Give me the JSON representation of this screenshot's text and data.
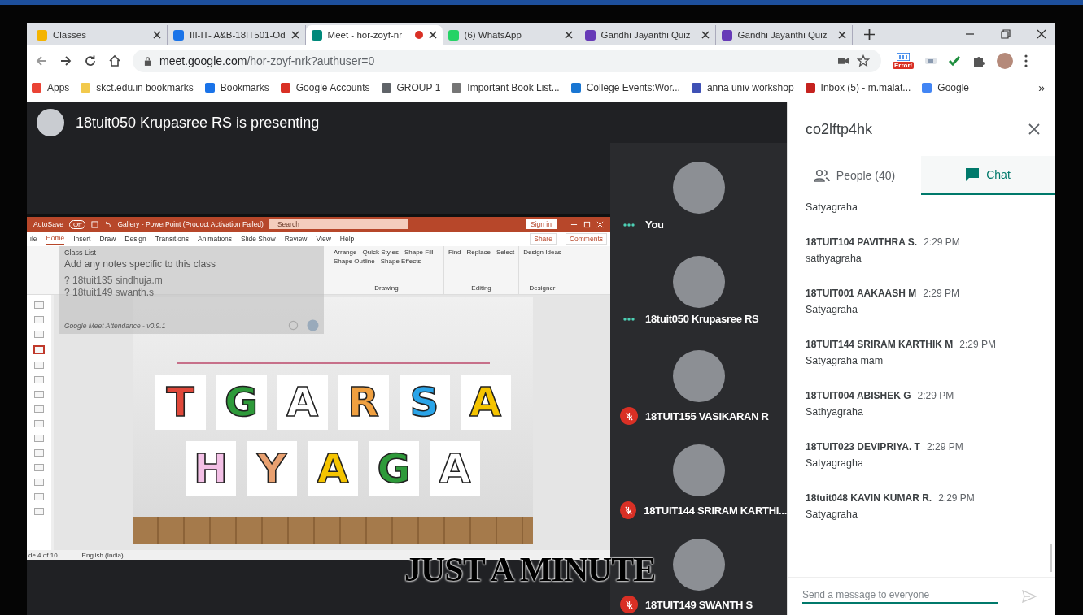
{
  "browser": {
    "tabs": [
      {
        "title": "Classes",
        "color": "#f4b400",
        "recording": false,
        "selected": false
      },
      {
        "title": "III-IT- A&B-18IT501-Od",
        "color": "#1a73e8",
        "recording": false,
        "selected": false
      },
      {
        "title": "Meet - hor-zoyf-nr",
        "color": "#00897b",
        "recording": true,
        "selected": true
      },
      {
        "title": "(6) WhatsApp",
        "color": "#25d366",
        "recording": false,
        "selected": false
      },
      {
        "title": "Gandhi Jayanthi Quiz",
        "color": "#673ab7",
        "recording": false,
        "selected": false
      },
      {
        "title": "Gandhi Jayanthi Quiz",
        "color": "#673ab7",
        "recording": false,
        "selected": false
      }
    ],
    "address": {
      "host": "meet.google.com",
      "path": "/hor-zoyf-nrk?authuser=0"
    },
    "extension_badge": "Error!",
    "bookmarks": [
      {
        "label": "Apps",
        "color": "#ea4335"
      },
      {
        "label": "skct.edu.in bookmarks",
        "color": "#f2c94c"
      },
      {
        "label": "Bookmarks",
        "color": "#1a73e8"
      },
      {
        "label": "Google Accounts",
        "color": "#d93025"
      },
      {
        "label": "GROUP 1",
        "color": "#5f6368"
      },
      {
        "label": "Important Book List...",
        "color": "#757575"
      },
      {
        "label": "College Events:Wor...",
        "color": "#1976d2"
      },
      {
        "label": "anna univ workshop",
        "color": "#3f51b5"
      },
      {
        "label": "Inbox (5) - m.malat...",
        "color": "#c5221f"
      },
      {
        "label": "Google",
        "color": "#4285f4"
      }
    ],
    "more_bookmarks": "»"
  },
  "meet": {
    "presenter": "18tuit050 Krupasree RS is presenting",
    "presentation": {
      "autosave": "AutoSave",
      "autosave_state": "Off",
      "title": "Gallery - PowerPoint (Product Activation Failed)",
      "search_placeholder": "Search",
      "sign_in": "Sign in",
      "tabs": [
        {
          "label": "ile",
          "selected": false
        },
        {
          "label": "Home",
          "selected": true
        },
        {
          "label": "Insert",
          "selected": false
        },
        {
          "label": "Draw",
          "selected": false
        },
        {
          "label": "Design",
          "selected": false
        },
        {
          "label": "Transitions",
          "selected": false
        },
        {
          "label": "Animations",
          "selected": false
        },
        {
          "label": "Slide Show",
          "selected": false
        },
        {
          "label": "Review",
          "selected": false
        },
        {
          "label": "View",
          "selected": false
        },
        {
          "label": "Help",
          "selected": false
        }
      ],
      "share": "Share",
      "comments": "Comments",
      "groups": [
        {
          "label": "Drawing",
          "commands": [
            "Arrange",
            "Quick Styles",
            "Shape Fill",
            "Shape Outline",
            "Shape Effects"
          ]
        },
        {
          "label": "Editing",
          "commands": [
            "Find",
            "Replace",
            "Select"
          ]
        },
        {
          "label": "Designer",
          "commands": [
            "Design Ideas"
          ]
        }
      ],
      "thumbnails": [
        {
          "selected": false
        },
        {
          "selected": false
        },
        {
          "selected": false
        },
        {
          "selected": true
        },
        {
          "selected": false
        },
        {
          "selected": false
        },
        {
          "selected": false
        },
        {
          "selected": false
        },
        {
          "selected": false
        },
        {
          "selected": false
        },
        {
          "selected": false
        },
        {
          "selected": false
        },
        {
          "selected": false
        },
        {
          "selected": false
        },
        {
          "selected": false
        }
      ],
      "slide_rows": [
        [
          {
            "letter": "T",
            "color": "#e0483a"
          },
          {
            "letter": "G",
            "color": "#2e9a3a"
          },
          {
            "letter": "A",
            "color": "#ffffff"
          },
          {
            "letter": "R",
            "color": "#f0a040"
          },
          {
            "letter": "S",
            "color": "#2aa4e8"
          },
          {
            "letter": "A",
            "color": "#f5c400"
          }
        ],
        [
          {
            "letter": "H",
            "color": "#f3c0e6"
          },
          {
            "letter": "Y",
            "color": "#e8a070"
          },
          {
            "letter": "A",
            "color": "#f5c400"
          },
          {
            "letter": "G",
            "color": "#2e9a3a"
          },
          {
            "letter": "A",
            "color": "#ffffff"
          }
        ]
      ],
      "status": {
        "slide": "de 4 of 10",
        "language": "English (India)"
      },
      "attendance_overlay": {
        "class_list": "Class List",
        "notes_placeholder": "Add any notes specific to this class",
        "absent": [
          "? 18tuit135 sindhuja.m",
          "? 18tuit149 swanth.s"
        ],
        "footer": "Google Meet Attendance - v0.9.1"
      }
    },
    "participants": [
      {
        "name": "You",
        "muted": false
      },
      {
        "name": "18tuit050 Krupasree RS",
        "muted": false
      },
      {
        "name": "18TUIT155 VASIKARAN R",
        "muted": true
      },
      {
        "name": "18TUIT144 SRIRAM KARTHI...",
        "muted": true
      },
      {
        "name": "18TUIT149 SWANTH S",
        "muted": true
      }
    ]
  },
  "side_panel": {
    "meeting_code": "co2lftp4hk",
    "tabs": [
      {
        "label": "People (40)",
        "kind": "people",
        "selected": false
      },
      {
        "label": "Chat",
        "kind": "chat",
        "selected": true
      }
    ],
    "messages": [
      {
        "text": "Satyagraha"
      },
      {
        "sender": "18TUIT104 PAVITHRA S.",
        "time": "2:29 PM",
        "text": "sathyagraha"
      },
      {
        "sender": "18TUIT001 AAKAASH M",
        "time": "2:29 PM",
        "text": "Satyagraha"
      },
      {
        "sender": "18TUIT144 SRIRAM KARTHIK M",
        "time": "2:29 PM",
        "text": "Satyagraha mam"
      },
      {
        "sender": "18TUIT004 ABISHEK G",
        "time": "2:29 PM",
        "text": "Sathyagraha"
      },
      {
        "sender": "18TUIT023 DEVIPRIYA. T",
        "time": "2:29 PM",
        "text": "Satyagragha"
      },
      {
        "sender": "18tuit048 KAVIN KUMAR R.",
        "time": "2:29 PM",
        "text": "Satyagraha"
      }
    ],
    "composer": {
      "placeholder": "Send a message to everyone"
    }
  },
  "caption": "JUST A MINUTE"
}
